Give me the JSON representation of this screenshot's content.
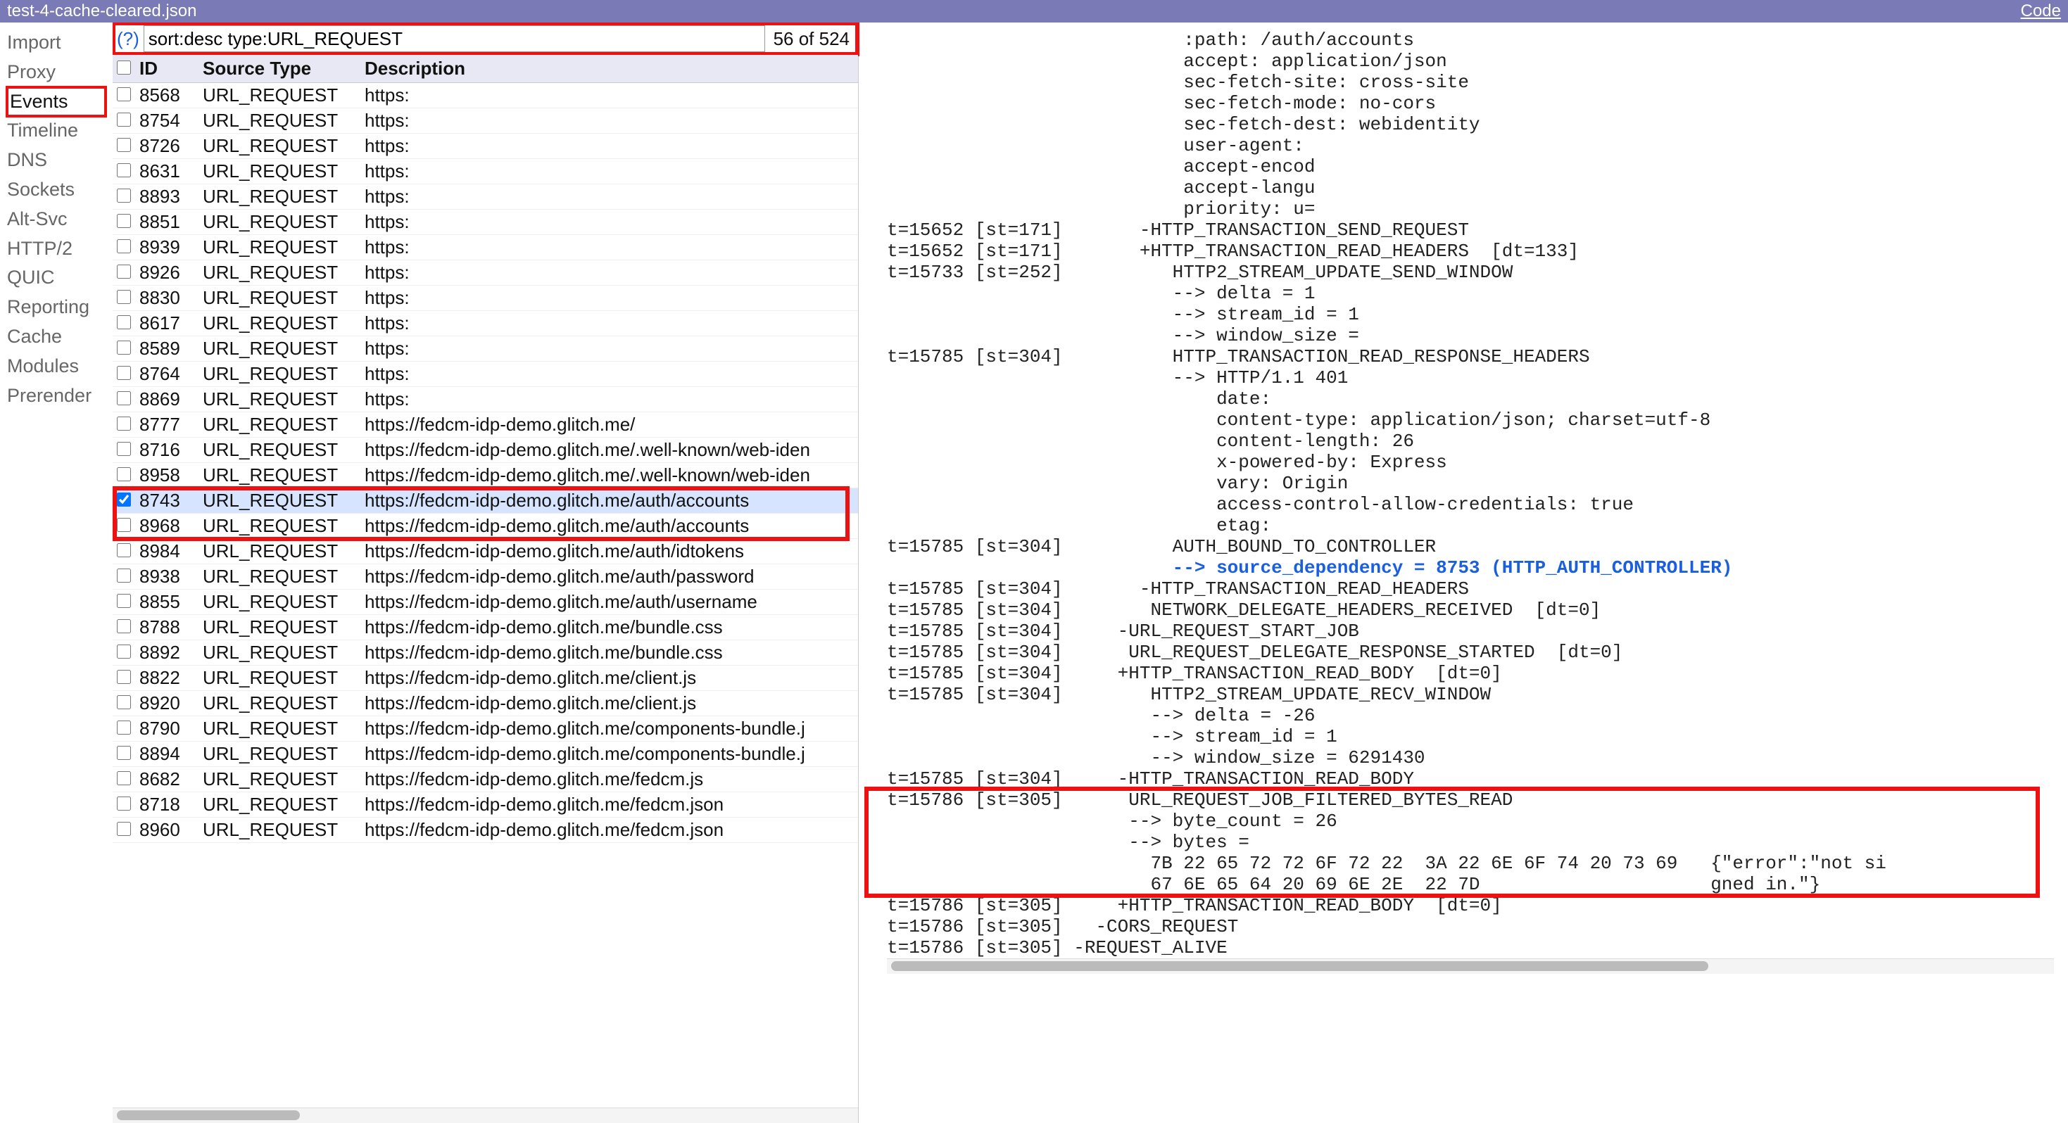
{
  "titlebar": {
    "filename": "test-4-cache-cleared.json",
    "code_link": "Code"
  },
  "sidebar": {
    "items": [
      {
        "label": "Import"
      },
      {
        "label": "Proxy"
      },
      {
        "label": "Events",
        "selected": true
      },
      {
        "label": "Timeline"
      },
      {
        "label": "DNS"
      },
      {
        "label": "Sockets"
      },
      {
        "label": "Alt-Svc"
      },
      {
        "label": "HTTP/2"
      },
      {
        "label": "QUIC"
      },
      {
        "label": "Reporting"
      },
      {
        "label": "Cache"
      },
      {
        "label": "Modules"
      },
      {
        "label": "Prerender"
      }
    ]
  },
  "filter": {
    "help": "(?)",
    "value": "sort:desc type:URL_REQUEST",
    "count": "56 of 524"
  },
  "table": {
    "headers": {
      "cb": "",
      "id": "ID",
      "type": "Source Type",
      "desc": "Description"
    },
    "rows": [
      {
        "id": "8568",
        "type": "URL_REQUEST",
        "desc": "https:"
      },
      {
        "id": "8754",
        "type": "URL_REQUEST",
        "desc": "https:"
      },
      {
        "id": "8726",
        "type": "URL_REQUEST",
        "desc": "https:"
      },
      {
        "id": "8631",
        "type": "URL_REQUEST",
        "desc": "https:"
      },
      {
        "id": "8893",
        "type": "URL_REQUEST",
        "desc": "https:"
      },
      {
        "id": "8851",
        "type": "URL_REQUEST",
        "desc": "https:"
      },
      {
        "id": "8939",
        "type": "URL_REQUEST",
        "desc": "https:"
      },
      {
        "id": "8926",
        "type": "URL_REQUEST",
        "desc": "https:"
      },
      {
        "id": "8830",
        "type": "URL_REQUEST",
        "desc": "https:"
      },
      {
        "id": "8617",
        "type": "URL_REQUEST",
        "desc": "https:"
      },
      {
        "id": "8589",
        "type": "URL_REQUEST",
        "desc": "https:"
      },
      {
        "id": "8764",
        "type": "URL_REQUEST",
        "desc": "https:"
      },
      {
        "id": "8869",
        "type": "URL_REQUEST",
        "desc": "https:"
      },
      {
        "id": "8777",
        "type": "URL_REQUEST",
        "desc": "https://fedcm-idp-demo.glitch.me/"
      },
      {
        "id": "8716",
        "type": "URL_REQUEST",
        "desc": "https://fedcm-idp-demo.glitch.me/.well-known/web-iden"
      },
      {
        "id": "8958",
        "type": "URL_REQUEST",
        "desc": "https://fedcm-idp-demo.glitch.me/.well-known/web-iden"
      },
      {
        "id": "8743",
        "type": "URL_REQUEST",
        "desc": "https://fedcm-idp-demo.glitch.me/auth/accounts",
        "selected": true,
        "checked": true
      },
      {
        "id": "8968",
        "type": "URL_REQUEST",
        "desc": "https://fedcm-idp-demo.glitch.me/auth/accounts"
      },
      {
        "id": "8984",
        "type": "URL_REQUEST",
        "desc": "https://fedcm-idp-demo.glitch.me/auth/idtokens"
      },
      {
        "id": "8938",
        "type": "URL_REQUEST",
        "desc": "https://fedcm-idp-demo.glitch.me/auth/password"
      },
      {
        "id": "8855",
        "type": "URL_REQUEST",
        "desc": "https://fedcm-idp-demo.glitch.me/auth/username"
      },
      {
        "id": "8788",
        "type": "URL_REQUEST",
        "desc": "https://fedcm-idp-demo.glitch.me/bundle.css"
      },
      {
        "id": "8892",
        "type": "URL_REQUEST",
        "desc": "https://fedcm-idp-demo.glitch.me/bundle.css"
      },
      {
        "id": "8822",
        "type": "URL_REQUEST",
        "desc": "https://fedcm-idp-demo.glitch.me/client.js"
      },
      {
        "id": "8920",
        "type": "URL_REQUEST",
        "desc": "https://fedcm-idp-demo.glitch.me/client.js"
      },
      {
        "id": "8790",
        "type": "URL_REQUEST",
        "desc": "https://fedcm-idp-demo.glitch.me/components-bundle.j"
      },
      {
        "id": "8894",
        "type": "URL_REQUEST",
        "desc": "https://fedcm-idp-demo.glitch.me/components-bundle.j"
      },
      {
        "id": "8682",
        "type": "URL_REQUEST",
        "desc": "https://fedcm-idp-demo.glitch.me/fedcm.js"
      },
      {
        "id": "8718",
        "type": "URL_REQUEST",
        "desc": "https://fedcm-idp-demo.glitch.me/fedcm.json"
      },
      {
        "id": "8960",
        "type": "URL_REQUEST",
        "desc": "https://fedcm-idp-demo.glitch.me/fedcm.json"
      }
    ]
  },
  "detail": {
    "pre_lines": [
      "                           :path: /auth/accounts",
      "                           accept: application/json",
      "                           sec-fetch-site: cross-site",
      "                           sec-fetch-mode: no-cors",
      "                           sec-fetch-dest: webidentity",
      "                           user-agent:",
      "                           accept-encod",
      "                           accept-langu",
      "                           priority: u=",
      "t=15652 [st=171]       -HTTP_TRANSACTION_SEND_REQUEST",
      "t=15652 [st=171]       +HTTP_TRANSACTION_READ_HEADERS  [dt=133]",
      "t=15733 [st=252]          HTTP2_STREAM_UPDATE_SEND_WINDOW",
      "                          --> delta = 1",
      "                          --> stream_id = 1",
      "                          --> window_size =",
      "t=15785 [st=304]          HTTP_TRANSACTION_READ_RESPONSE_HEADERS",
      "                          --> HTTP/1.1 401",
      "                              date:",
      "                              content-type: application/json; charset=utf-8",
      "                              content-length: 26",
      "                              x-powered-by: Express",
      "                              vary: Origin",
      "                              access-control-allow-credentials: true",
      "                              etag:",
      "t=15785 [st=304]          AUTH_BOUND_TO_CONTROLLER"
    ],
    "blue_line": "                          --> source_dependency = 8753 (HTTP_AUTH_CONTROLLER)",
    "mid_lines": [
      "t=15785 [st=304]       -HTTP_TRANSACTION_READ_HEADERS",
      "t=15785 [st=304]        NETWORK_DELEGATE_HEADERS_RECEIVED  [dt=0]",
      "t=15785 [st=304]     -URL_REQUEST_START_JOB",
      "t=15785 [st=304]      URL_REQUEST_DELEGATE_RESPONSE_STARTED  [dt=0]",
      "t=15785 [st=304]     +HTTP_TRANSACTION_READ_BODY  [dt=0]",
      "t=15785 [st=304]        HTTP2_STREAM_UPDATE_RECV_WINDOW",
      "                        --> delta = -26",
      "                        --> stream_id = 1",
      "                        --> window_size = 6291430",
      "t=15785 [st=304]     -HTTP_TRANSACTION_READ_BODY"
    ],
    "boxed_lines": [
      "t=15786 [st=305]      URL_REQUEST_JOB_FILTERED_BYTES_READ",
      "                      --> byte_count = 26",
      "                      --> bytes =",
      "                        7B 22 65 72 72 6F 72 22  3A 22 6E 6F 74 20 73 69   {\"error\":\"not si",
      "                        67 6E 65 64 20 69 6E 2E  22 7D                     gned in.\"}"
    ],
    "post_lines": [
      "t=15786 [st=305]     +HTTP_TRANSACTION_READ_BODY  [dt=0]",
      "t=15786 [st=305]   -CORS_REQUEST",
      "t=15786 [st=305] -REQUEST_ALIVE"
    ]
  }
}
